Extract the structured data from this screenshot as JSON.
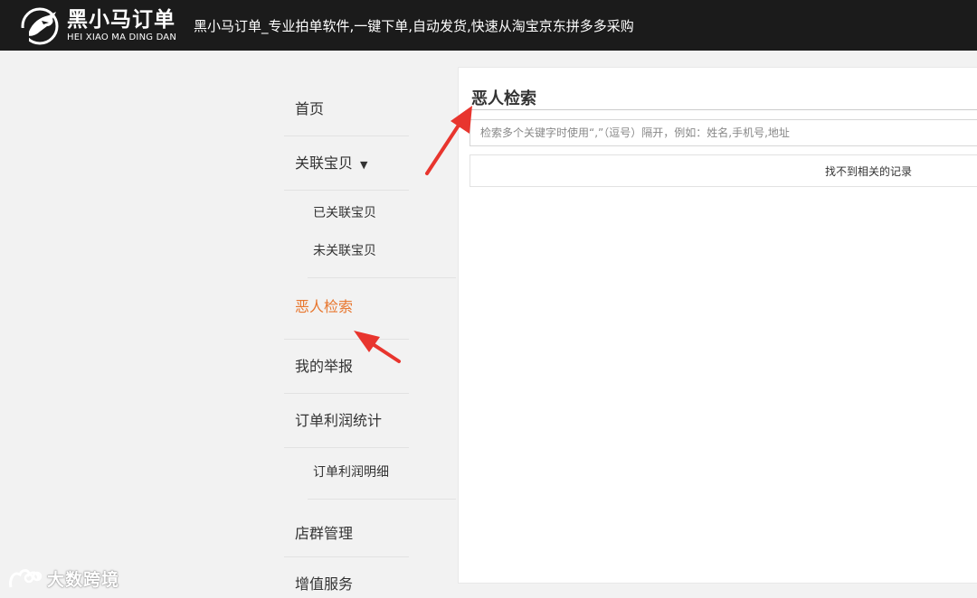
{
  "header": {
    "logo_cn": "黑小马订单",
    "logo_en": "HEI XIAO MA DING DAN",
    "slogan": "黑小马订单_专业拍单软件,一键下单,自动发货,快速从淘宝京东拼多多采购"
  },
  "sidebar": {
    "items": [
      {
        "label": "首页"
      },
      {
        "label": "关联宝贝",
        "caret": "▼"
      },
      {
        "label": "恶人检索",
        "active": true
      },
      {
        "label": "我的举报"
      },
      {
        "label": "订单利润统计"
      },
      {
        "label": "店群管理"
      },
      {
        "label": "增值服务"
      }
    ],
    "sub_related": [
      "已关联宝贝",
      "未关联宝贝"
    ],
    "sub_profit": [
      "订单利润明细"
    ]
  },
  "main": {
    "title": "恶人检索",
    "search_placeholder": "检索多个关键字时使用“,”（逗号）隔开，例如：姓名,手机号,地址",
    "empty_message": "找不到相关的记录"
  },
  "watermark": {
    "text": "大数跨境"
  },
  "colors": {
    "accent": "#e8772f",
    "header_bg": "#1b1b1b",
    "annotation_arrow": "#e8352e"
  }
}
